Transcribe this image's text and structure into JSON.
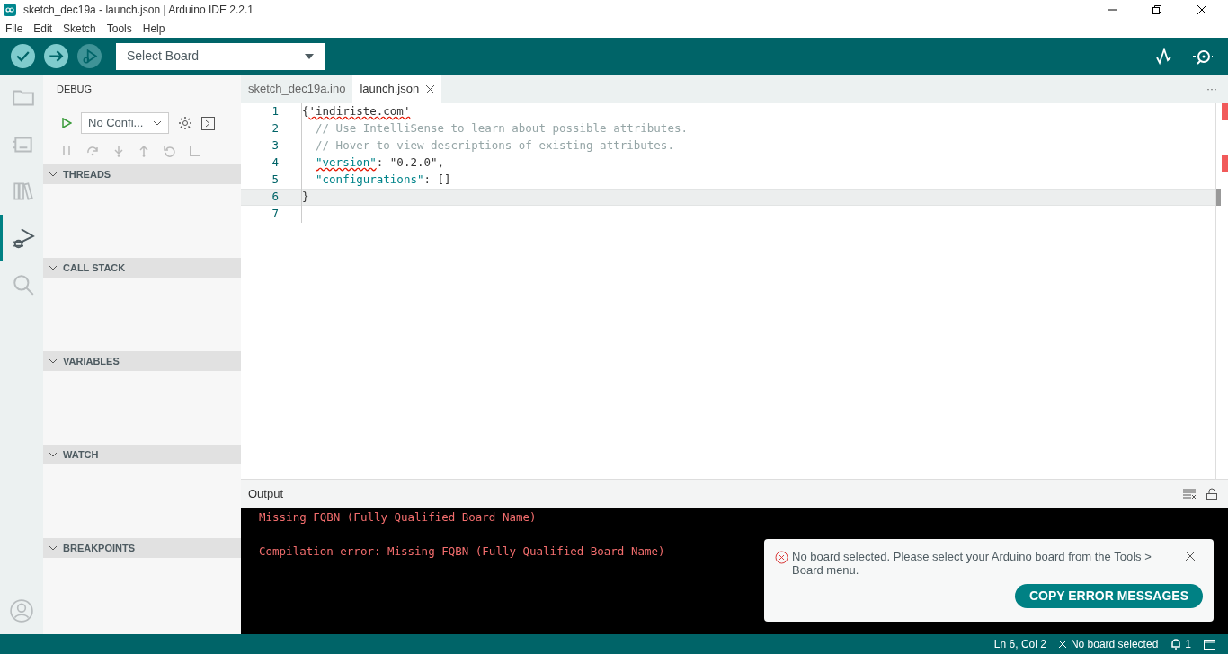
{
  "window": {
    "title": "sketch_dec19a - launch.json | Arduino IDE 2.2.1"
  },
  "menu": [
    "File",
    "Edit",
    "Sketch",
    "Tools",
    "Help"
  ],
  "toolbar": {
    "buttons": [
      {
        "kind": "verify",
        "disabled": false
      },
      {
        "kind": "upload",
        "disabled": false
      },
      {
        "kind": "debug",
        "disabled": true
      }
    ],
    "board_select": {
      "value": "Select Board"
    }
  },
  "activity_bar": [
    {
      "kind": "folder",
      "selected": false
    },
    {
      "kind": "board",
      "selected": false
    },
    {
      "kind": "library",
      "selected": false
    },
    {
      "kind": "debug",
      "selected": true
    },
    {
      "kind": "search",
      "selected": false
    }
  ],
  "sidebar": {
    "title": "DEBUG",
    "config_select": {
      "value": "No Confi..."
    },
    "sections": [
      {
        "label": "THREADS",
        "expanded": true
      },
      {
        "label": "CALL STACK",
        "expanded": true
      },
      {
        "label": "VARIABLES",
        "expanded": true
      },
      {
        "label": "WATCH",
        "expanded": true
      },
      {
        "label": "BREAKPOINTS",
        "expanded": true
      }
    ]
  },
  "tabs": [
    {
      "label": "sketch_dec19a.ino",
      "selected": false
    },
    {
      "label": "launch.json",
      "selected": true
    }
  ],
  "tab_bar_more": "···",
  "editor": {
    "lines": [
      {
        "number": "1",
        "kind": "brace",
        "current": false,
        "tokens": [
          {
            "text": "{",
            "kind": "punct",
            "squiggle": false
          },
          {
            "text": "'indiriste.com'",
            "kind": "plain",
            "squiggle": true
          }
        ]
      },
      {
        "number": "2",
        "kind": "member",
        "current": false,
        "tokens": [
          {
            "text": "// Use IntelliSense to learn about possible attributes.",
            "kind": "comment",
            "squiggle": false
          }
        ]
      },
      {
        "number": "3",
        "kind": "member",
        "current": false,
        "tokens": [
          {
            "text": "// Hover to view descriptions of existing attributes.",
            "kind": "comment",
            "squiggle": false
          }
        ]
      },
      {
        "number": "4",
        "kind": "member",
        "current": false,
        "tokens": [
          {
            "text": "\"version\"",
            "kind": "key",
            "squiggle": true
          },
          {
            "text": ": ",
            "kind": "plain",
            "squiggle": false
          },
          {
            "text": "\"0.2.0\"",
            "kind": "string",
            "squiggle": false
          },
          {
            "text": ",",
            "kind": "plain",
            "squiggle": false
          }
        ]
      },
      {
        "number": "5",
        "kind": "member",
        "current": false,
        "tokens": [
          {
            "text": "\"configurations\"",
            "kind": "key",
            "squiggle": false
          },
          {
            "text": ": []",
            "kind": "plain",
            "squiggle": false
          }
        ]
      },
      {
        "number": "6",
        "kind": "brace",
        "current": true,
        "tokens": [
          {
            "text": "}",
            "kind": "punct",
            "squiggle": false
          }
        ]
      },
      {
        "number": "7",
        "current": false
      }
    ]
  },
  "output": {
    "title": "Output",
    "lines": [
      "Missing FQBN (Fully Qualified Board Name)",
      "Compilation error: Missing FQBN (Fully Qualified Board Name)"
    ]
  },
  "notification": {
    "message": "No board selected. Please select your Arduino board from the Tools > Board menu.",
    "button": "COPY ERROR MESSAGES"
  },
  "status_bar": {
    "position": "Ln 6, Col 2",
    "board": "No board selected",
    "notifications": "1"
  }
}
